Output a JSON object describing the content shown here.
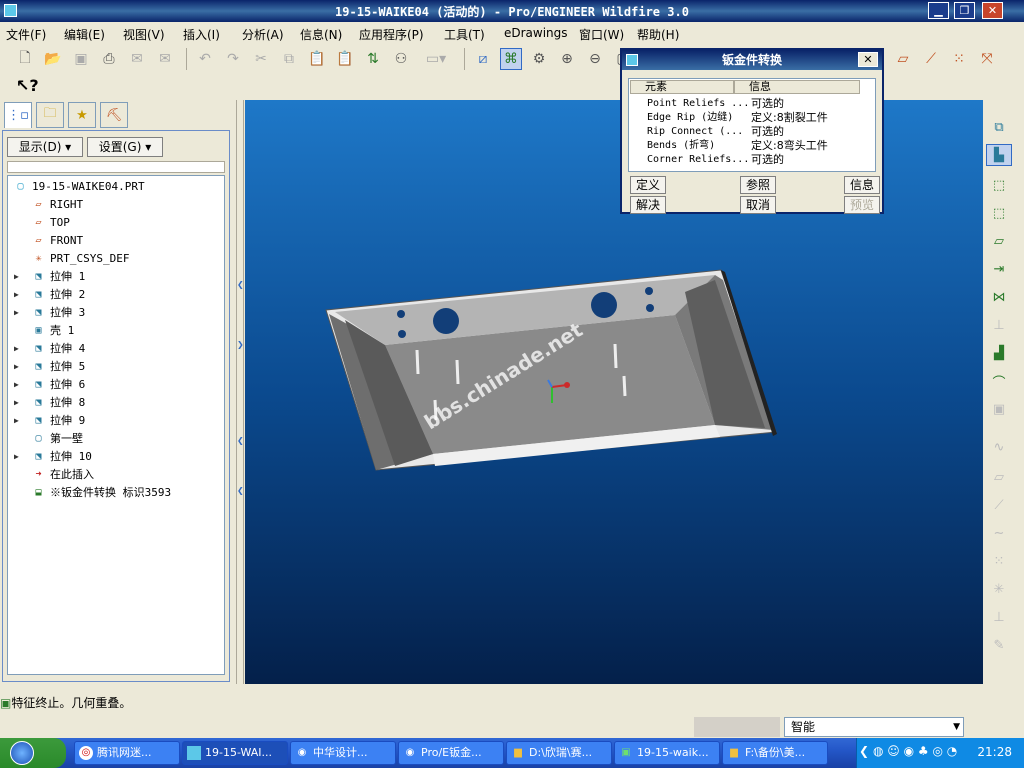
{
  "window": {
    "title": "19-15-WAIKE04 (活动的) - Pro/ENGINEER Wildfire 3.0",
    "min": "▁",
    "max": "❐",
    "close": "✕"
  },
  "menu": [
    "文件(F)",
    "编辑(E)",
    "视图(V)",
    "插入(I)",
    "分析(A)",
    "信息(N)",
    "应用程序(P)",
    "工具(T)",
    "eDrawings",
    "窗口(W)",
    "帮助(H)"
  ],
  "panel": {
    "display_btn": "显示(D) ▾",
    "settings_btn": "设置(G) ▾",
    "tree": [
      {
        "label": "19-15-WAIKE04.PRT",
        "icon": "part-icon",
        "expand": false,
        "indent": 0
      },
      {
        "label": "RIGHT",
        "icon": "datum-plane-icon",
        "expand": false,
        "indent": 1
      },
      {
        "label": "TOP",
        "icon": "datum-plane-icon",
        "expand": false,
        "indent": 1
      },
      {
        "label": "FRONT",
        "icon": "datum-plane-icon",
        "expand": false,
        "indent": 1
      },
      {
        "label": "PRT_CSYS_DEF",
        "icon": "csys-icon",
        "expand": false,
        "indent": 1
      },
      {
        "label": "拉伸 1",
        "icon": "extrude-icon",
        "expand": true,
        "indent": 1
      },
      {
        "label": "拉伸 2",
        "icon": "extrude-icon",
        "expand": true,
        "indent": 1
      },
      {
        "label": "拉伸 3",
        "icon": "extrude-icon",
        "expand": true,
        "indent": 1
      },
      {
        "label": "壳 1",
        "icon": "shell-icon",
        "expand": false,
        "indent": 1
      },
      {
        "label": "拉伸 4",
        "icon": "extrude-icon",
        "expand": true,
        "indent": 1
      },
      {
        "label": "拉伸 5",
        "icon": "extrude-icon",
        "expand": true,
        "indent": 1
      },
      {
        "label": "拉伸 6",
        "icon": "extrude-icon",
        "expand": true,
        "indent": 1
      },
      {
        "label": "拉伸 8",
        "icon": "extrude-icon",
        "expand": true,
        "indent": 1
      },
      {
        "label": "拉伸 9",
        "icon": "extrude-icon",
        "expand": true,
        "indent": 1
      },
      {
        "label": "第一壁",
        "icon": "wall-icon",
        "expand": false,
        "indent": 1
      },
      {
        "label": "拉伸 10",
        "icon": "extrude-icon",
        "expand": true,
        "indent": 1
      },
      {
        "label": "在此插入",
        "icon": "insert-arrow-icon",
        "expand": false,
        "indent": 1
      },
      {
        "label": "※钣金件转换 标识3593",
        "icon": "sheetmetal-convert-icon",
        "expand": false,
        "indent": 1
      }
    ]
  },
  "dialog": {
    "title": "钣金件转换",
    "col_element": "元素",
    "col_info": "信息",
    "rows": [
      {
        "element": "Point Reliefs ...",
        "info": "可选的"
      },
      {
        "element": "Edge Rip (边缝)",
        "info": "定义:8割裂工件"
      },
      {
        "element": "Rip Connect (...",
        "info": "可选的"
      },
      {
        "element": "Bends (折弯)",
        "info": "定义:8弯头工件"
      },
      {
        "element": "Corner Reliefs...",
        "info": "可选的"
      }
    ],
    "btn_define": "定义",
    "btn_refs": "参照",
    "btn_info": "信息",
    "btn_cancel_all": "解决",
    "btn_cancel": "取消",
    "btn_preview": "预览"
  },
  "viewport": {
    "watermark": "bbs.chinade.net"
  },
  "status": {
    "message": "特征终止。几何重叠。",
    "filter": "智能"
  },
  "taskbar": {
    "items": [
      {
        "label": "腾讯网迷...",
        "icon": "browser-icon"
      },
      {
        "label": "19-15-WAI...",
        "icon": "proe-icon"
      },
      {
        "label": "中华设计...",
        "icon": "web-icon"
      },
      {
        "label": "Pro/E钣金...",
        "icon": "web-icon"
      },
      {
        "label": "D:\\欣瑞\\赛...",
        "icon": "folder-icon"
      },
      {
        "label": "19-15-waik...",
        "icon": "proe-icon"
      },
      {
        "label": "F:\\备份\\美...",
        "icon": "folder-icon"
      }
    ],
    "clock": "21:28"
  },
  "colors": {
    "viewport_top": "#1e78c8",
    "viewport_bottom": "#04204a",
    "title_bar": "#0a246a"
  }
}
